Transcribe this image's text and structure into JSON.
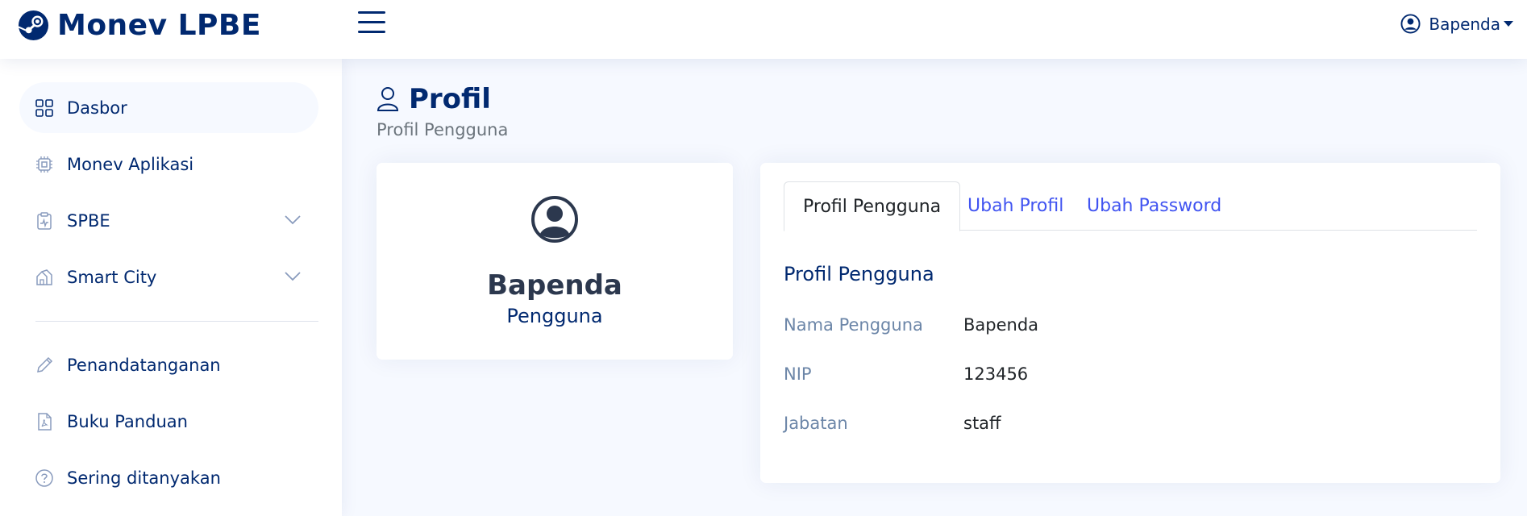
{
  "header": {
    "app_title": "Monev LPBE",
    "user_name": "Bapenda"
  },
  "sidebar": {
    "items": [
      {
        "label": "Dasbor",
        "icon": "grid-icon",
        "active": true
      },
      {
        "label": "Monev Aplikasi",
        "icon": "cpu-icon"
      },
      {
        "label": "SPBE",
        "icon": "clipboard-pulse-icon",
        "expandable": true
      },
      {
        "label": "Smart City",
        "icon": "houses-icon",
        "expandable": true
      },
      {
        "label": "Penandatanganan",
        "icon": "pencil-icon"
      },
      {
        "label": "Buku Panduan",
        "icon": "file-pdf-icon"
      },
      {
        "label": "Sering ditanyakan",
        "icon": "question-circle-icon"
      }
    ]
  },
  "page": {
    "title": "Profil",
    "subtitle": "Profil Pengguna"
  },
  "profile_card": {
    "name": "Bapenda",
    "role": "Pengguna"
  },
  "detail_card": {
    "tabs": [
      {
        "label": "Profil Pengguna",
        "active": true
      },
      {
        "label": "Ubah Profil"
      },
      {
        "label": "Ubah Password"
      }
    ],
    "section_title": "Profil Pengguna",
    "rows": [
      {
        "label": "Nama Pengguna",
        "value": "Bapenda"
      },
      {
        "label": "NIP",
        "value": "123456"
      },
      {
        "label": "Jabatan",
        "value": "staff"
      }
    ]
  },
  "colors": {
    "brand": "#012970",
    "accent": "#4154f1",
    "page_bg": "#f6f9ff"
  }
}
